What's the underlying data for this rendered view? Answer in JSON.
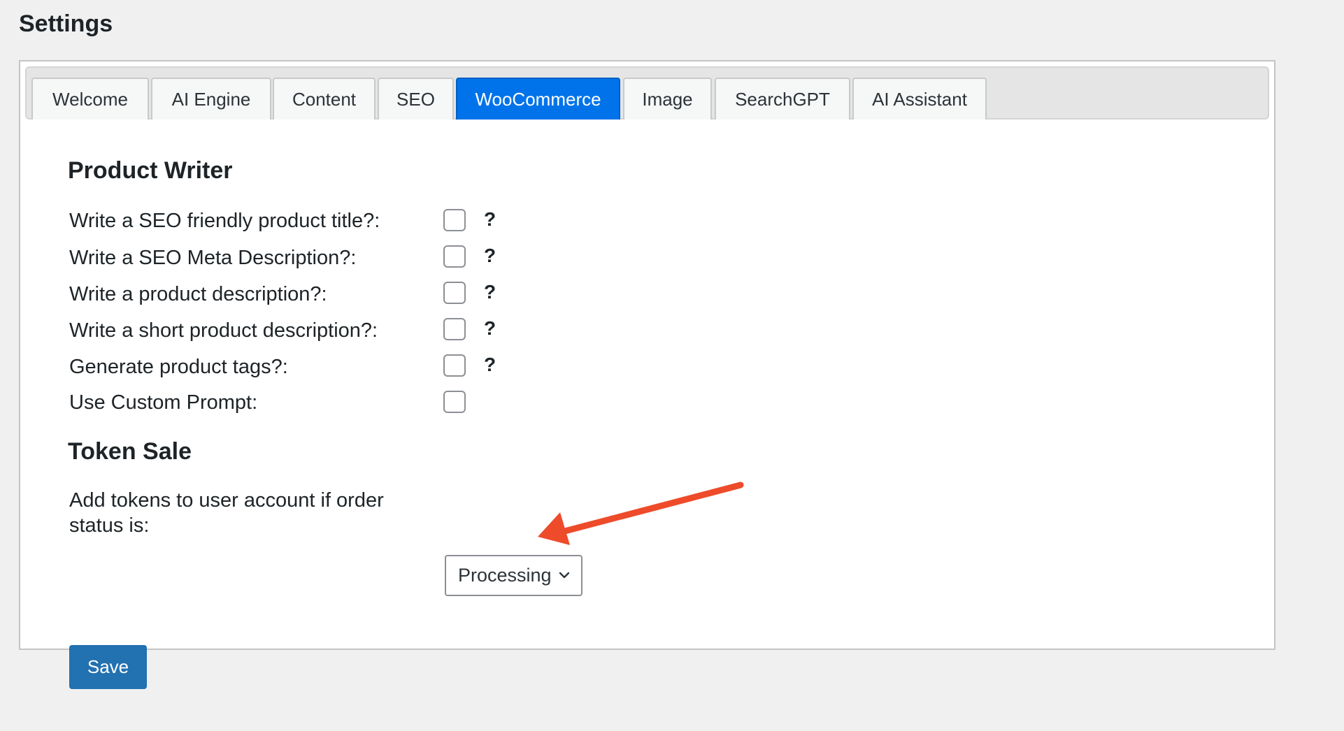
{
  "page": {
    "title": "Settings"
  },
  "tabs": [
    {
      "label": "Welcome",
      "active": false
    },
    {
      "label": "AI Engine",
      "active": false
    },
    {
      "label": "Content",
      "active": false
    },
    {
      "label": "SEO",
      "active": false
    },
    {
      "label": "WooCommerce",
      "active": true
    },
    {
      "label": "Image",
      "active": false
    },
    {
      "label": "SearchGPT",
      "active": false
    },
    {
      "label": "AI Assistant",
      "active": false
    }
  ],
  "product_writer": {
    "title": "Product Writer",
    "options": [
      {
        "label": "Write a SEO friendly product title?:",
        "checked": false,
        "help": "?"
      },
      {
        "label": "Write a SEO Meta Description?:",
        "checked": false,
        "help": "?"
      },
      {
        "label": "Write a product description?:",
        "checked": false,
        "help": "?"
      },
      {
        "label": "Write a short product description?:",
        "checked": false,
        "help": "?"
      },
      {
        "label": "Generate product tags?:",
        "checked": false,
        "help": "?"
      },
      {
        "label": "Use Custom Prompt:",
        "checked": false
      }
    ]
  },
  "token_sale": {
    "title": "Token Sale",
    "order_status_label": "Add tokens to user account if order status is:",
    "order_status_value": "Processing"
  },
  "actions": {
    "save_label": "Save"
  },
  "colors": {
    "active_tab": "#0073ea",
    "save_button": "#2271b1",
    "annotation_arrow": "#ee4b2b"
  },
  "annotation": {
    "icon": "arrow-annotation-icon"
  }
}
